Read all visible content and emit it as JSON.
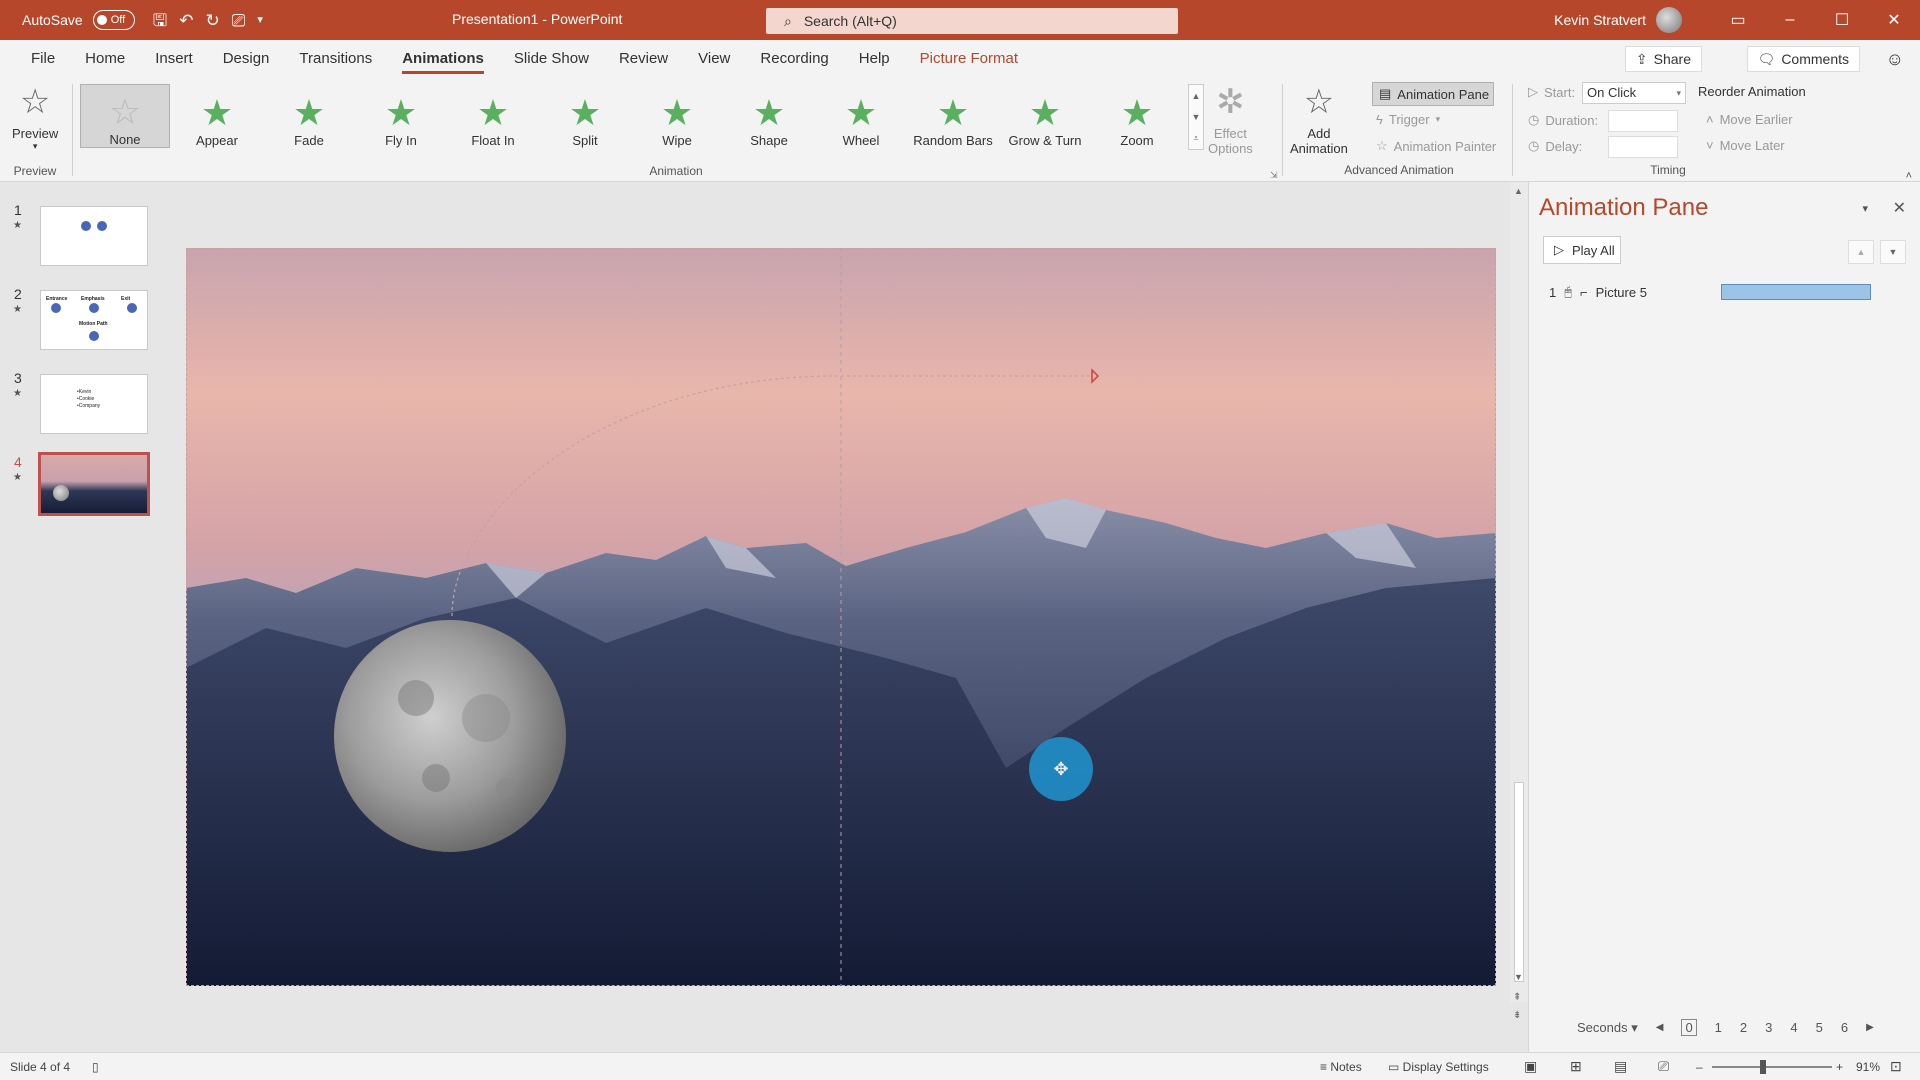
{
  "titlebar": {
    "autosave_label": "AutoSave",
    "autosave_state": "Off",
    "doc_title": "Presentation1  -  PowerPoint",
    "search_placeholder": "Search (Alt+Q)",
    "user_name": "Kevin Stratvert"
  },
  "menu": {
    "tabs": [
      "File",
      "Home",
      "Insert",
      "Design",
      "Transitions",
      "Animations",
      "Slide Show",
      "Review",
      "View",
      "Recording",
      "Help",
      "Picture Format"
    ],
    "active_tab": "Animations",
    "share_label": "Share",
    "comments_label": "Comments"
  },
  "ribbon": {
    "preview_label": "Preview",
    "preview_group": "Preview",
    "animation_group": "Animation",
    "animations": [
      "None",
      "Appear",
      "Fade",
      "Fly In",
      "Float In",
      "Split",
      "Wipe",
      "Shape",
      "Wheel",
      "Random Bars",
      "Grow & Turn",
      "Zoom"
    ],
    "effect_options_line1": "Effect",
    "effect_options_line2": "Options",
    "add_animation_line1": "Add",
    "add_animation_line2": "Animation",
    "animation_pane_label": "Animation Pane",
    "trigger_label": "Trigger",
    "animation_painter_label": "Animation Painter",
    "advanced_group": "Advanced Animation",
    "start_label": "Start:",
    "start_value": "On Click",
    "duration_label": "Duration:",
    "delay_label": "Delay:",
    "reorder_label": "Reorder Animation",
    "move_earlier_label": "Move Earlier",
    "move_later_label": "Move Later",
    "timing_group": "Timing"
  },
  "slides": {
    "numbers": [
      "1",
      "2",
      "3",
      "4"
    ],
    "slide2_labels": [
      "Entrance",
      "Emphasis",
      "Exit",
      "Motion Path"
    ],
    "slide3_lines": [
      "•Kevin",
      "•Cookie",
      "•Company"
    ]
  },
  "anim_pane": {
    "title": "Animation Pane",
    "play_all": "Play All",
    "item_number": "1",
    "item_name": "Picture 5",
    "seconds_label": "Seconds",
    "ticks": [
      "0",
      "1",
      "2",
      "3",
      "4",
      "5",
      "6"
    ]
  },
  "statusbar": {
    "slide_info": "Slide 4 of 4",
    "notes_label": "Notes",
    "display_settings_label": "Display Settings",
    "zoom_value": "91%"
  },
  "colors": {
    "accent": "#b7472a",
    "anim_star": "#5ab05f",
    "timeline_bar": "#9dc3e6",
    "motion_marker": "#1f8fc8"
  }
}
